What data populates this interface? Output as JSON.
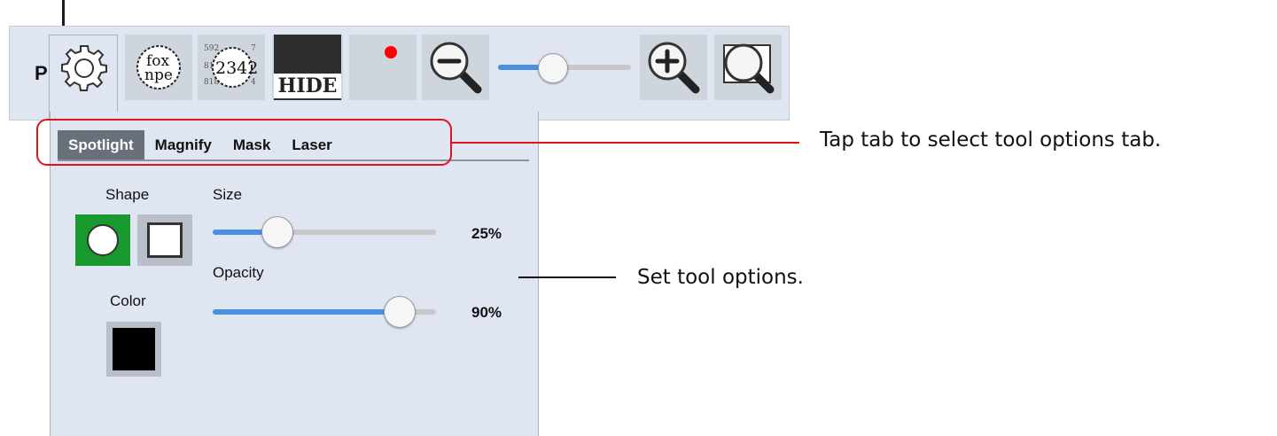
{
  "toolbar": {
    "letter": "P",
    "magnify_text_line1": "fox",
    "magnify_text_line2": "npe",
    "mask_number": "2342",
    "hide_label": "HIDE",
    "buttons": [
      {
        "name": "tools-gear",
        "icon": "gear-icon"
      },
      {
        "name": "spotlight",
        "icon": "spotlight-text-icon"
      },
      {
        "name": "magnify",
        "icon": "magnify-numbers-icon"
      },
      {
        "name": "mask",
        "icon": "hide-mask-icon"
      },
      {
        "name": "laser",
        "icon": "laser-dot-icon"
      },
      {
        "name": "zoom-out",
        "icon": "zoom-out-icon"
      },
      {
        "name": "zoom-in",
        "icon": "zoom-in-icon"
      },
      {
        "name": "zoom-fit",
        "icon": "zoom-fit-icon"
      }
    ],
    "zoom_level_fraction": 0.42
  },
  "panel": {
    "tabs": [
      {
        "label": "Spotlight",
        "active": true
      },
      {
        "label": "Magnify",
        "active": false
      },
      {
        "label": "Mask",
        "active": false
      },
      {
        "label": "Laser",
        "active": false
      }
    ],
    "shape_label": "Shape",
    "shapes": [
      {
        "name": "circle",
        "selected": true
      },
      {
        "name": "square",
        "selected": false
      }
    ],
    "color_label": "Color",
    "color_value": "#000000",
    "size_label": "Size",
    "size_value": "25%",
    "size_fraction": 0.25,
    "opacity_label": "Opacity",
    "opacity_value": "90%",
    "opacity_fraction": 0.9
  },
  "callouts": {
    "tabs": "Tap tab to select tool options tab.",
    "options": "Set tool options."
  },
  "colors": {
    "accent_blue": "#4a90e2",
    "highlight_red": "#e0141e",
    "selected_green": "#1a9a2e",
    "laser_red": "#ff0000",
    "active_tab": "#6a7079"
  }
}
